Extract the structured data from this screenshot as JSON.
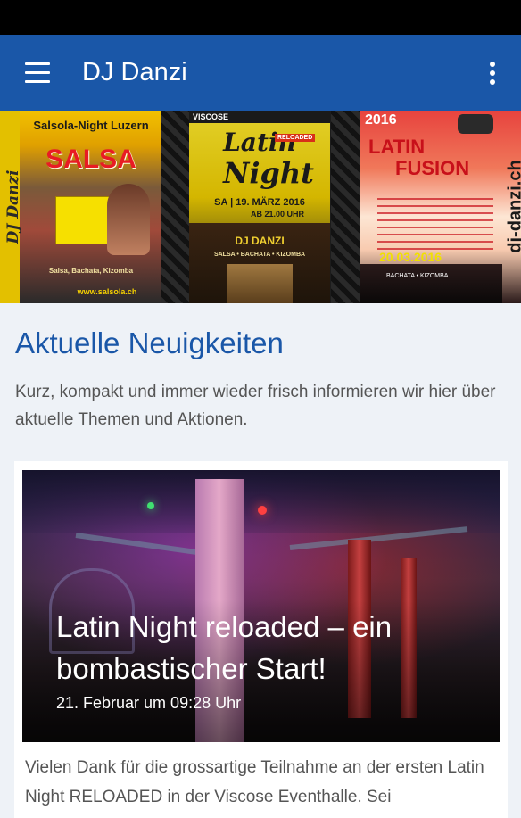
{
  "app": {
    "title": "DJ Danzi"
  },
  "banner": {
    "flyer_salsa": {
      "heading": "Salsola-Night Luzern",
      "title": "SALSA",
      "side_text": "DJ Danzi",
      "styles_line": "Salsa, Bachata, Kizomba",
      "url": "www.salsola.ch"
    },
    "flyer_latin": {
      "venue": "VISCOSE",
      "title_line1": "Latin",
      "title_line2": "Night",
      "badge": "RELOADED",
      "date": "SA | 19. MÄRZ 2016",
      "time": "AB 21.00 UHR",
      "dj": "DJ DANZI",
      "styles_line": "SALSA • BACHATA • KIZOMBA"
    },
    "flyer_fusion": {
      "year": "2016",
      "title_line1": "LATIN",
      "title_line2": "FUSION",
      "date": "20.03.2016",
      "styles_line": "BACHATA • KIZOMBA",
      "side_text": "dj-danzi.ch"
    }
  },
  "section": {
    "title": "Aktuelle Neuigkeiten",
    "intro": "Kurz, kompakt und immer wieder frisch informieren wir hier über aktuelle Themen und Aktionen."
  },
  "post": {
    "title": "Latin Night reloaded – ein bombastischer Start!",
    "date": "21. Februar um 09:28 Uhr",
    "excerpt": "Vielen Dank für die grossartige Teilnahme an der ersten Latin Night RELOADED in der Viscose Eventhalle. Sei"
  },
  "colors": {
    "primary": "#1a57a8",
    "background": "#eef2f7",
    "text_muted": "#555555"
  },
  "icons": {
    "menu": "menu-icon",
    "overflow": "more-vert-icon"
  }
}
